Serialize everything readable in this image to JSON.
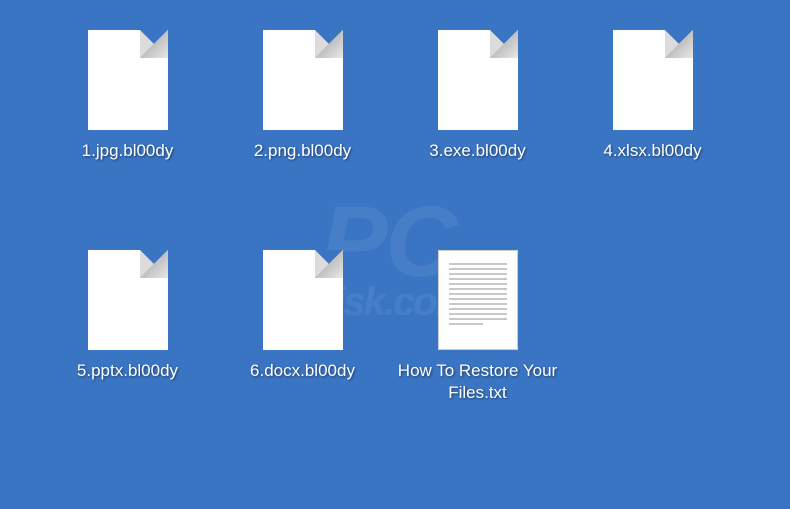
{
  "watermark": {
    "main": "PC",
    "sub": "risk.com"
  },
  "files": [
    {
      "name": "1.jpg.bl00dy",
      "type": "blank"
    },
    {
      "name": "2.png.bl00dy",
      "type": "blank"
    },
    {
      "name": "3.exe.bl00dy",
      "type": "blank"
    },
    {
      "name": "4.xlsx.bl00dy",
      "type": "blank"
    },
    {
      "name": "5.pptx.bl00dy",
      "type": "blank"
    },
    {
      "name": "6.docx.bl00dy",
      "type": "blank"
    },
    {
      "name": "How To Restore Your Files.txt",
      "type": "text"
    }
  ]
}
